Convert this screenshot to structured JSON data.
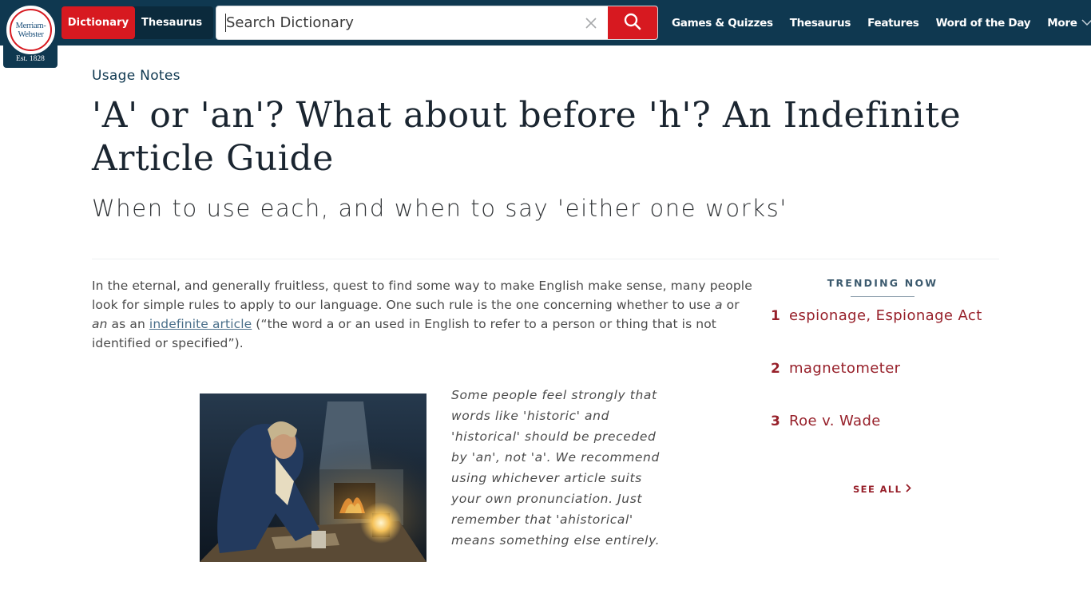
{
  "header": {
    "logo": {
      "line1": "Merriam-",
      "line2": "Webster",
      "est": "Est. 1828"
    },
    "tabs": [
      {
        "label": "Dictionary",
        "active": true
      },
      {
        "label": "Thesaurus",
        "active": false
      }
    ],
    "search": {
      "placeholder": "Search Dictionary",
      "value": "",
      "clear_icon": "close-icon",
      "submit_icon": "search-icon"
    },
    "nav": [
      {
        "label": "Games & Quizzes"
      },
      {
        "label": "Thesaurus"
      },
      {
        "label": "Features"
      },
      {
        "label": "Word of the Day"
      },
      {
        "label": "More",
        "icon": "chevron-down-icon"
      }
    ],
    "colors": {
      "navy": "#0f3850",
      "red": "#d71920"
    }
  },
  "article": {
    "eyebrow": "Usage Notes",
    "title": "'A' or 'an'? What about before 'h'? An Indefinite Article Guide",
    "subtitle": "When to use each, and when to say 'either one works'",
    "intro": {
      "part1": "In the eternal, and generally fruitless, quest to find some way to make English make sense, many people look for simple rules to apply to our language. One such rule is the one concerning whether to use ",
      "em_a": "a",
      "part2": " or ",
      "em_an": "an",
      "part3": " as an ",
      "link": "indefinite article",
      "part4": " (“the word a or an used in English to refer to a person or thing that is not identified or specified”)."
    },
    "figure": {
      "alt": "Man in 18th-century clothing leaning over a table by lantern and fireplace light"
    },
    "caption": "Some people feel strongly that words like 'historic' and 'historical' should be preceded by 'an', not 'a'. We recommend using whichever article suits your own pronunciation. Just remember that 'ahistorical' means something else entirely."
  },
  "trending": {
    "heading": "TRENDING NOW",
    "items": [
      {
        "rank": "1",
        "word": "espionage, Espionage Act"
      },
      {
        "rank": "2",
        "word": "magnetometer"
      },
      {
        "rank": "3",
        "word": "Roe v. Wade"
      }
    ],
    "see_all": "SEE ALL",
    "accent": "#97202a"
  }
}
